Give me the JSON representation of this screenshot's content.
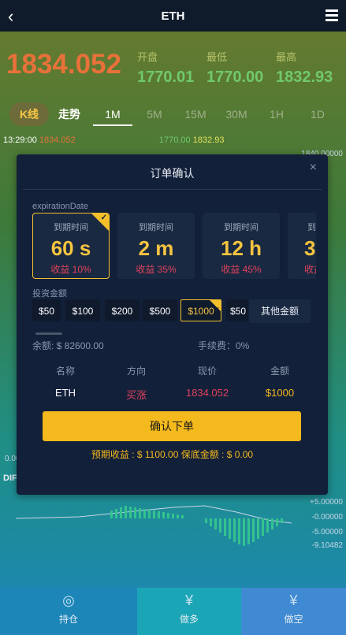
{
  "header": {
    "title": "ETH"
  },
  "quote": {
    "price": "1834.052",
    "open_label": "开盘",
    "open": "1770.01",
    "low_label": "最低",
    "low": "1770.00",
    "high_label": "最高",
    "high": "1832.93"
  },
  "tabs": [
    "K线",
    "走势",
    "1M",
    "5M",
    "15M",
    "30M",
    "1H",
    "1D"
  ],
  "ticker": {
    "time": "13:29:00",
    "a": "1834.052",
    "b": "1770.00",
    "c": "1832.93"
  },
  "axis": {
    "right": [
      "1840.00000",
      "+5.00000",
      "-0.00000",
      "-5.00000",
      "-9.10482"
    ],
    "left": [
      "0.00",
      "DIF"
    ]
  },
  "modal": {
    "title": "订单确认",
    "close": "×",
    "expiration_label": "expirationDate",
    "cards": [
      {
        "title": "到期时间",
        "value": "60 s",
        "yield": "收益 10%"
      },
      {
        "title": "到期时间",
        "value": "2 m",
        "yield": "收益 35%"
      },
      {
        "title": "到期时间",
        "value": "12 h",
        "yield": "收益 45%"
      },
      {
        "title": "到期",
        "value": "3",
        "yield": "收益"
      }
    ],
    "amount_label": "投资金额",
    "amounts": [
      "$50",
      "$100",
      "$200",
      "$500",
      "$1000",
      "$50"
    ],
    "other_amount": "其他金额",
    "balance": "余额: $ 82600.00",
    "fee": "手续费：0%",
    "summary_headers": [
      "名称",
      "方向",
      "现价",
      "金额"
    ],
    "summary_values": [
      "ETH",
      "买涨",
      "1834.052",
      "$1000"
    ],
    "confirm": "确认下单",
    "expect": "预期收益 : $ 1100.00    保底金额 : $ 0.00"
  },
  "bottom": [
    {
      "icon": "hold-icon",
      "label": "持仓"
    },
    {
      "icon": "yen-icon",
      "label": "做多"
    },
    {
      "icon": "yen-icon",
      "label": "做空"
    }
  ],
  "colors": {
    "header_bg": "#0f1a2a",
    "price": "#e8713a",
    "up": "#71c96b",
    "modal_bg": "#13203a",
    "accent": "#f4b91c",
    "red": "#e0425a",
    "bottom_long": "#1ba6b8",
    "bottom_short": "#3f8ad2",
    "bottom_hold": "#1c86b9"
  }
}
